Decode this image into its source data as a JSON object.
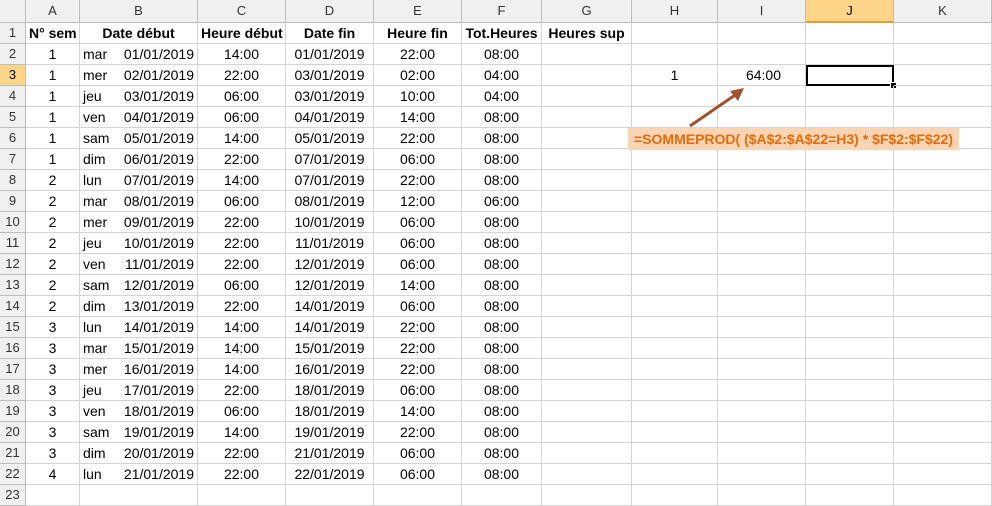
{
  "columns": [
    "A",
    "B",
    "C",
    "D",
    "E",
    "F",
    "G",
    "H",
    "I",
    "J",
    "K"
  ],
  "row_numbers": [
    "1",
    "2",
    "3",
    "4",
    "5",
    "6",
    "7",
    "8",
    "9",
    "10",
    "11",
    "12",
    "13",
    "14",
    "15",
    "16",
    "17",
    "18",
    "19",
    "20",
    "21",
    "22",
    "23"
  ],
  "headers": {
    "A": "N° sem",
    "B": "Date début",
    "C": "Heure début",
    "D": "Date fin",
    "E": "Heure fin",
    "F": "Tot.Heures",
    "G": "Heures sup"
  },
  "rows": [
    [
      "1",
      "mar",
      "01/01/2019",
      "14:00",
      "01/01/2019",
      "22:00",
      "08:00"
    ],
    [
      "1",
      "mer",
      "02/01/2019",
      "22:00",
      "03/01/2019",
      "02:00",
      "04:00"
    ],
    [
      "1",
      "jeu",
      "03/01/2019",
      "06:00",
      "03/01/2019",
      "10:00",
      "04:00"
    ],
    [
      "1",
      "ven",
      "04/01/2019",
      "06:00",
      "04/01/2019",
      "14:00",
      "08:00"
    ],
    [
      "1",
      "sam",
      "05/01/2019",
      "14:00",
      "05/01/2019",
      "22:00",
      "08:00"
    ],
    [
      "1",
      "dim",
      "06/01/2019",
      "22:00",
      "07/01/2019",
      "06:00",
      "08:00"
    ],
    [
      "2",
      "lun",
      "07/01/2019",
      "14:00",
      "07/01/2019",
      "22:00",
      "08:00"
    ],
    [
      "2",
      "mar",
      "08/01/2019",
      "06:00",
      "08/01/2019",
      "12:00",
      "06:00"
    ],
    [
      "2",
      "mer",
      "09/01/2019",
      "22:00",
      "10/01/2019",
      "06:00",
      "08:00"
    ],
    [
      "2",
      "jeu",
      "10/01/2019",
      "22:00",
      "11/01/2019",
      "06:00",
      "08:00"
    ],
    [
      "2",
      "ven",
      "11/01/2019",
      "22:00",
      "12/01/2019",
      "06:00",
      "08:00"
    ],
    [
      "2",
      "sam",
      "12/01/2019",
      "06:00",
      "12/01/2019",
      "14:00",
      "08:00"
    ],
    [
      "2",
      "dim",
      "13/01/2019",
      "22:00",
      "14/01/2019",
      "06:00",
      "08:00"
    ],
    [
      "3",
      "lun",
      "14/01/2019",
      "14:00",
      "14/01/2019",
      "22:00",
      "08:00"
    ],
    [
      "3",
      "mar",
      "15/01/2019",
      "14:00",
      "15/01/2019",
      "22:00",
      "08:00"
    ],
    [
      "3",
      "mer",
      "16/01/2019",
      "14:00",
      "16/01/2019",
      "22:00",
      "08:00"
    ],
    [
      "3",
      "jeu",
      "17/01/2019",
      "22:00",
      "18/01/2019",
      "06:00",
      "08:00"
    ],
    [
      "3",
      "ven",
      "18/01/2019",
      "06:00",
      "18/01/2019",
      "14:00",
      "08:00"
    ],
    [
      "3",
      "sam",
      "19/01/2019",
      "14:00",
      "19/01/2019",
      "22:00",
      "08:00"
    ],
    [
      "3",
      "dim",
      "20/01/2019",
      "22:00",
      "21/01/2019",
      "06:00",
      "08:00"
    ],
    [
      "4",
      "lun",
      "21/01/2019",
      "22:00",
      "22/01/2019",
      "06:00",
      "08:00"
    ]
  ],
  "extra": {
    "H3": "1",
    "I3": "64:00"
  },
  "formula_text": "=SOMMEPROD( ($A$2:$A$22=H3) * $F$2:$F$22)",
  "colors": {
    "arrow": "#a0522d",
    "formula_bg": "#fbd4b4",
    "formula_text": "#e36c09",
    "active_header": "#ffd58a"
  },
  "selected_cell": "J3"
}
